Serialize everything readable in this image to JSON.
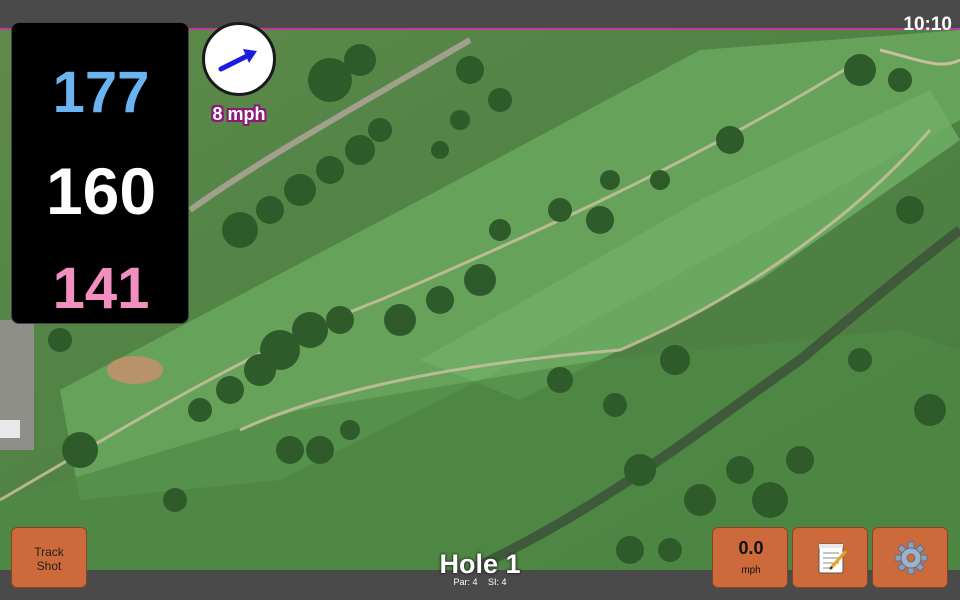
{
  "status_bar": {
    "time": "10:10"
  },
  "distances": {
    "back": "177",
    "middle": "160",
    "front": "141"
  },
  "wind": {
    "speed_label": "8 mph",
    "direction_icon": "wind-direction-arrow"
  },
  "hole": {
    "title": "Hole 1",
    "par": "Par: 4",
    "stroke_index": "SI: 4"
  },
  "buttons": {
    "track_shot_line1": "Track",
    "track_shot_line2": "Shot",
    "speed_value": "0.0",
    "speed_unit": "mph",
    "notes_icon": "notepad-icon",
    "settings_icon": "gear-icon"
  },
  "colors": {
    "back_distance": "#6ab4f2",
    "middle_distance": "#ffffff",
    "front_distance": "#f28ec0",
    "button": "#cd6a3c",
    "accent": "#c03aa0"
  }
}
